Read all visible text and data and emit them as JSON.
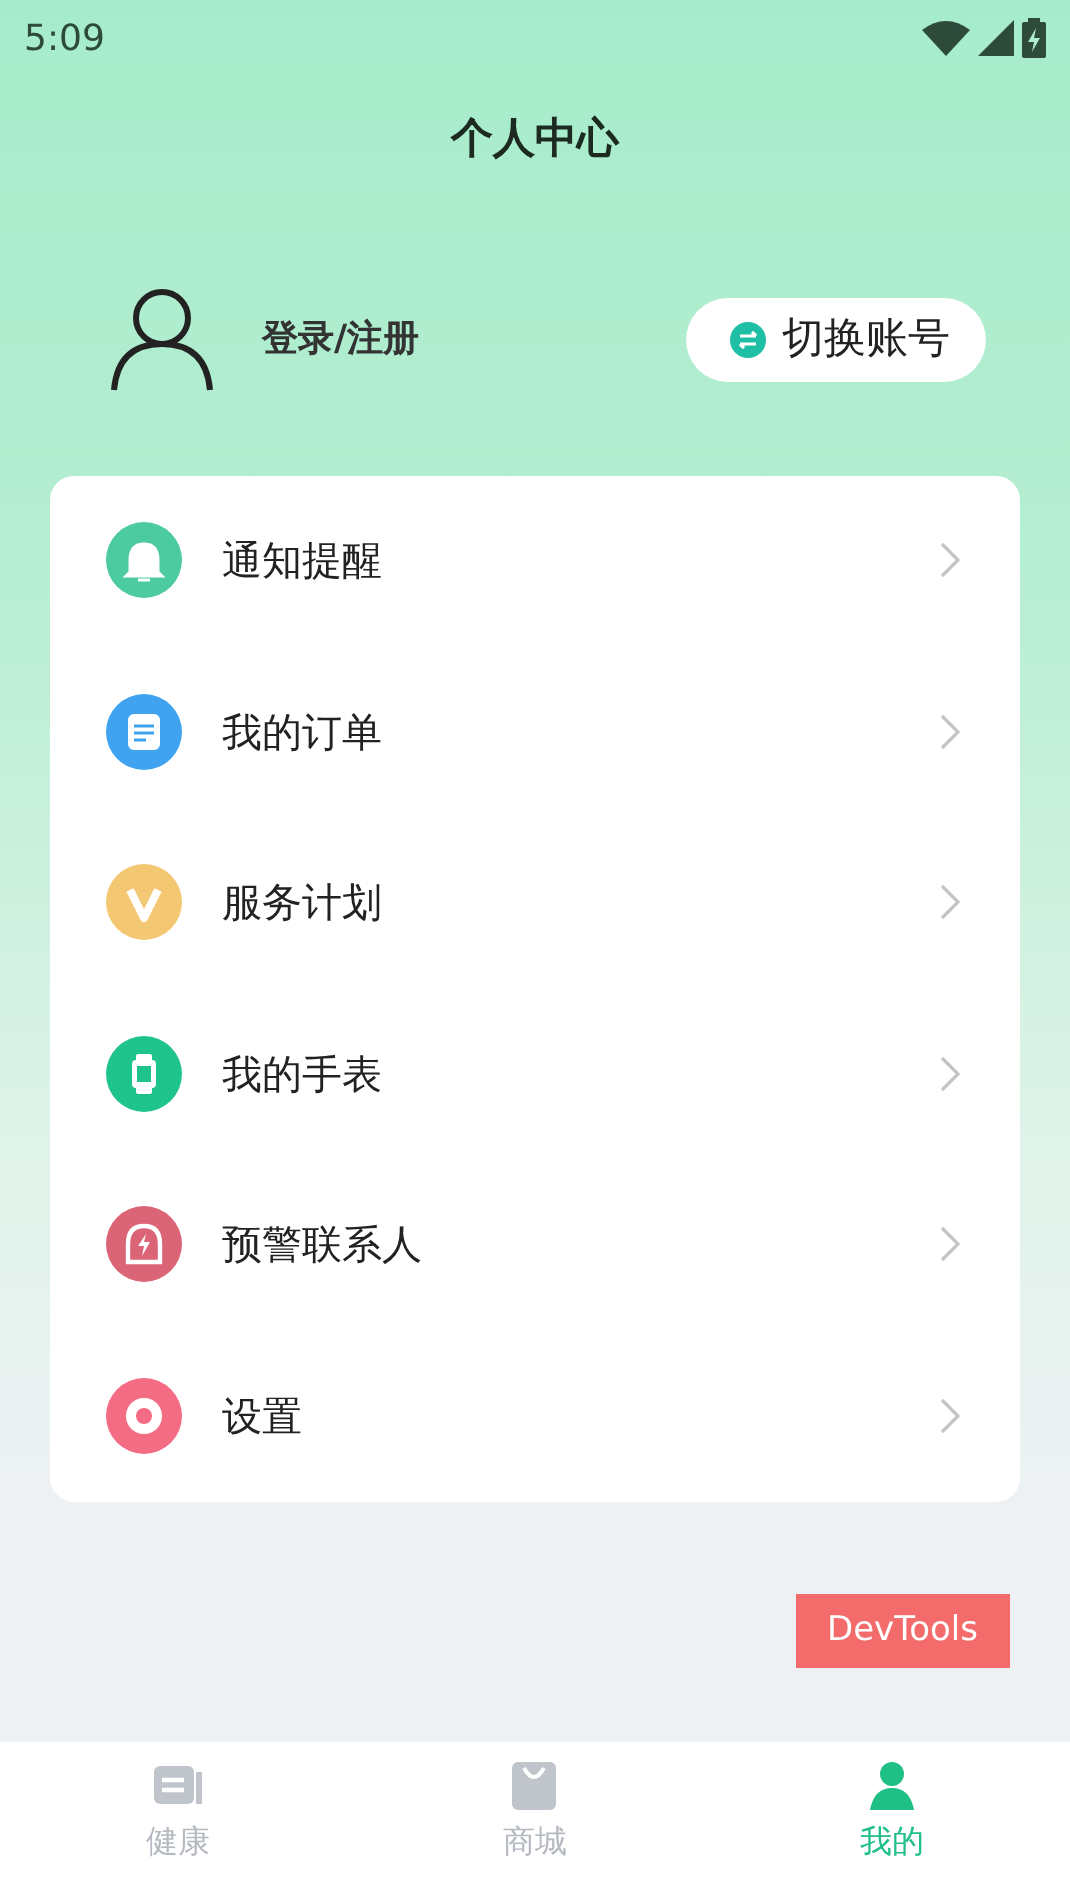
{
  "status_bar": {
    "time": "5:09"
  },
  "header": {
    "title": "个人中心"
  },
  "profile": {
    "login": "登录/注册",
    "switch_button": "切换账号"
  },
  "menu": [
    {
      "label": "通知提醒",
      "kind": "bell",
      "color": "#4ccaa0"
    },
    {
      "label": "我的订单",
      "kind": "document",
      "color": "#3fa3f0"
    },
    {
      "label": "服务计划",
      "kind": "v",
      "color": "#f4c873"
    },
    {
      "label": "我的手表",
      "kind": "watch",
      "color": "#1fc48c"
    },
    {
      "label": "预警联系人",
      "kind": "alarm",
      "color": "#dc6477"
    },
    {
      "label": "设置",
      "kind": "gear",
      "color": "#f36c84"
    }
  ],
  "devtools": "DevTools",
  "tabs": [
    {
      "label": "健康",
      "kind": "news",
      "selected": false
    },
    {
      "label": "商城",
      "kind": "bag",
      "selected": false
    },
    {
      "label": "我的",
      "kind": "person",
      "selected": true
    }
  ]
}
